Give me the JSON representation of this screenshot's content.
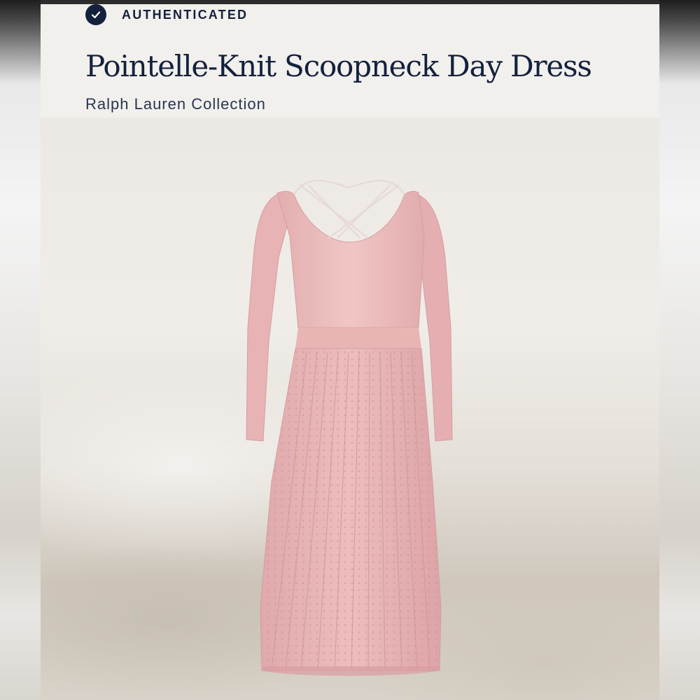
{
  "badge": {
    "icon": "checkmark-icon",
    "label": "AUTHENTICATED"
  },
  "product": {
    "title": "Pointelle-Knit Scoopneck Day Dress",
    "brand": "Ralph Lauren Collection",
    "image_icon": "dress-icon"
  },
  "colors": {
    "navy": "#14213d",
    "dress_pink": "#eab9b9"
  }
}
